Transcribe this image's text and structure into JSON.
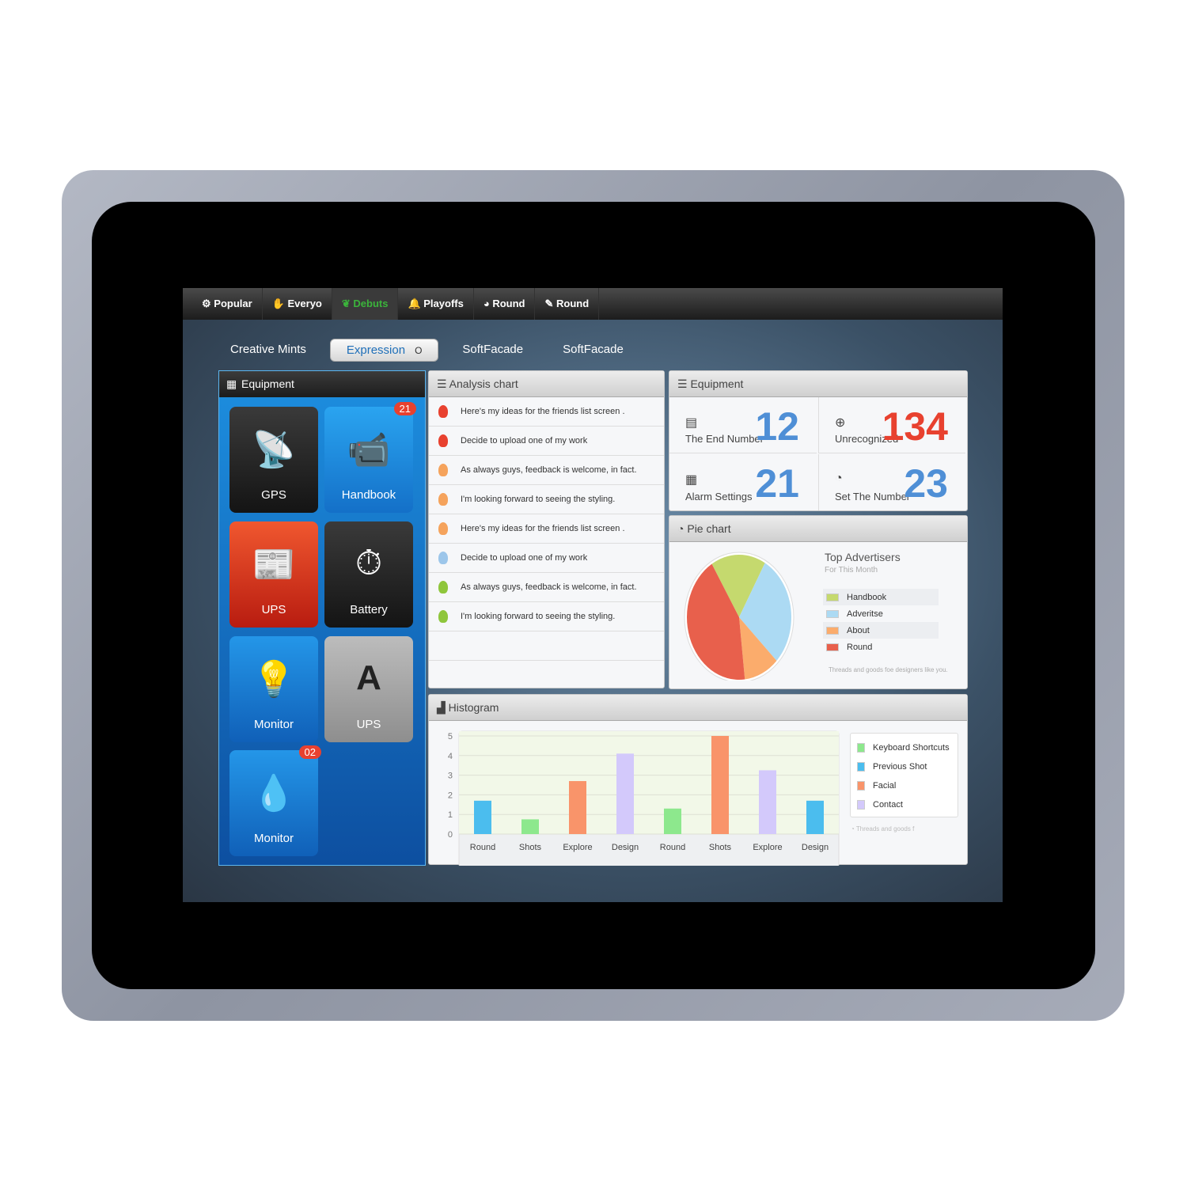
{
  "topnav": [
    {
      "icon": "gear-icon",
      "label": "Popular"
    },
    {
      "icon": "hand-icon",
      "label": "Everyo"
    },
    {
      "icon": "leaf-icon",
      "label": "Debuts",
      "active": true
    },
    {
      "icon": "bell-icon",
      "label": "Playoffs"
    },
    {
      "icon": "pacman-icon",
      "label": "Round"
    },
    {
      "icon": "feather-icon",
      "label": "Round"
    }
  ],
  "tabs": [
    {
      "label": "Creative Mints"
    },
    {
      "label": "Expression",
      "active": true,
      "indicator": "O"
    },
    {
      "label": "SoftFacade"
    },
    {
      "label": "SoftFacade"
    }
  ],
  "equipment": {
    "title": "Equipment",
    "tiles": [
      {
        "label": "GPS",
        "icon": "satellite-dish-icon"
      },
      {
        "label": "Handbook",
        "icon": "camera-icon",
        "badge": "21"
      },
      {
        "label": "UPS",
        "icon": "newspaper-icon"
      },
      {
        "label": "Battery",
        "icon": "stopwatch-icon"
      },
      {
        "label": "Monitor",
        "icon": "lightbulb-icon"
      },
      {
        "label": "UPS",
        "icon": "letter-a-icon"
      },
      {
        "label": "Monitor",
        "icon": "drop-icon",
        "badge": "02"
      }
    ]
  },
  "analysis": {
    "title": "Analysis chart",
    "items": [
      {
        "text": "Here's my ideas for the friends list screen .",
        "color": "#e8412f"
      },
      {
        "text": "Decide to upload one of my work",
        "color": "#e8412f"
      },
      {
        "text": "As always guys, feedback is welcome, in fact.",
        "color": "#f5a35c"
      },
      {
        "text": "I'm looking forward to seeing the styling.",
        "color": "#f5a35c"
      },
      {
        "text": "Here's my ideas for the friends list screen .",
        "color": "#f5a35c"
      },
      {
        "text": "Decide to upload one of my work",
        "color": "#9cc6ea"
      },
      {
        "text": "As always guys, feedback is welcome, in fact.",
        "color": "#8fc63c"
      },
      {
        "text": "I'm looking forward to seeing the styling.",
        "color": "#8fc63c"
      }
    ]
  },
  "stats": {
    "title": "Equipment",
    "items": [
      {
        "label": "The End Number",
        "value": "12",
        "color": "#4f8fd6",
        "icon": "calculator-icon"
      },
      {
        "label": "Unrecognized",
        "value": "134",
        "color": "#e8412f",
        "icon": "plus-circle-icon"
      },
      {
        "label": "Alarm Settings",
        "value": "21",
        "color": "#4f8fd6",
        "icon": "calendar-icon"
      },
      {
        "label": "Set The Number",
        "value": "23",
        "color": "#4f8fd6",
        "icon": "pie-icon"
      }
    ]
  },
  "pie": {
    "title": "Pie chart",
    "heading": "Top Advertisers",
    "subheading": "For This Month",
    "footer": "Threads and goods foe designers like you."
  },
  "histogram": {
    "title": "Histogram",
    "footer": "Threads and goods f"
  },
  "chart_data": [
    {
      "type": "pie",
      "title": "Top Advertisers",
      "labels": [
        "Handbook",
        "Adveritse",
        "About",
        "Round"
      ],
      "values": [
        17,
        29,
        11,
        43
      ],
      "colors": [
        "#c5d96e",
        "#acdaf3",
        "#fbac6c",
        "#e8604c"
      ]
    },
    {
      "type": "bar",
      "categories": [
        "Round",
        "Shots",
        "Explore",
        "Design",
        "Round",
        "Shots",
        "Explore",
        "Design"
      ],
      "values": [
        1.7,
        0.75,
        2.7,
        4.1,
        1.3,
        5,
        3.25,
        1.7
      ],
      "bar_series": [
        "Previous Shot",
        "Keyboard Shortcuts",
        "Facial",
        "Contact",
        "Keyboard Shortcuts",
        "Facial",
        "Contact",
        "Previous Shot"
      ],
      "ylim": [
        0,
        5
      ],
      "yticks": [
        0,
        1,
        2,
        3,
        4,
        5
      ],
      "grid": true,
      "legend": "right",
      "series": [
        {
          "name": "Keyboard Shortcuts",
          "color": "#8de88d"
        },
        {
          "name": "Previous Shot",
          "color": "#4bbdee"
        },
        {
          "name": "Facial",
          "color": "#f9946a"
        },
        {
          "name": "Contact",
          "color": "#d3c9fb"
        }
      ]
    }
  ]
}
